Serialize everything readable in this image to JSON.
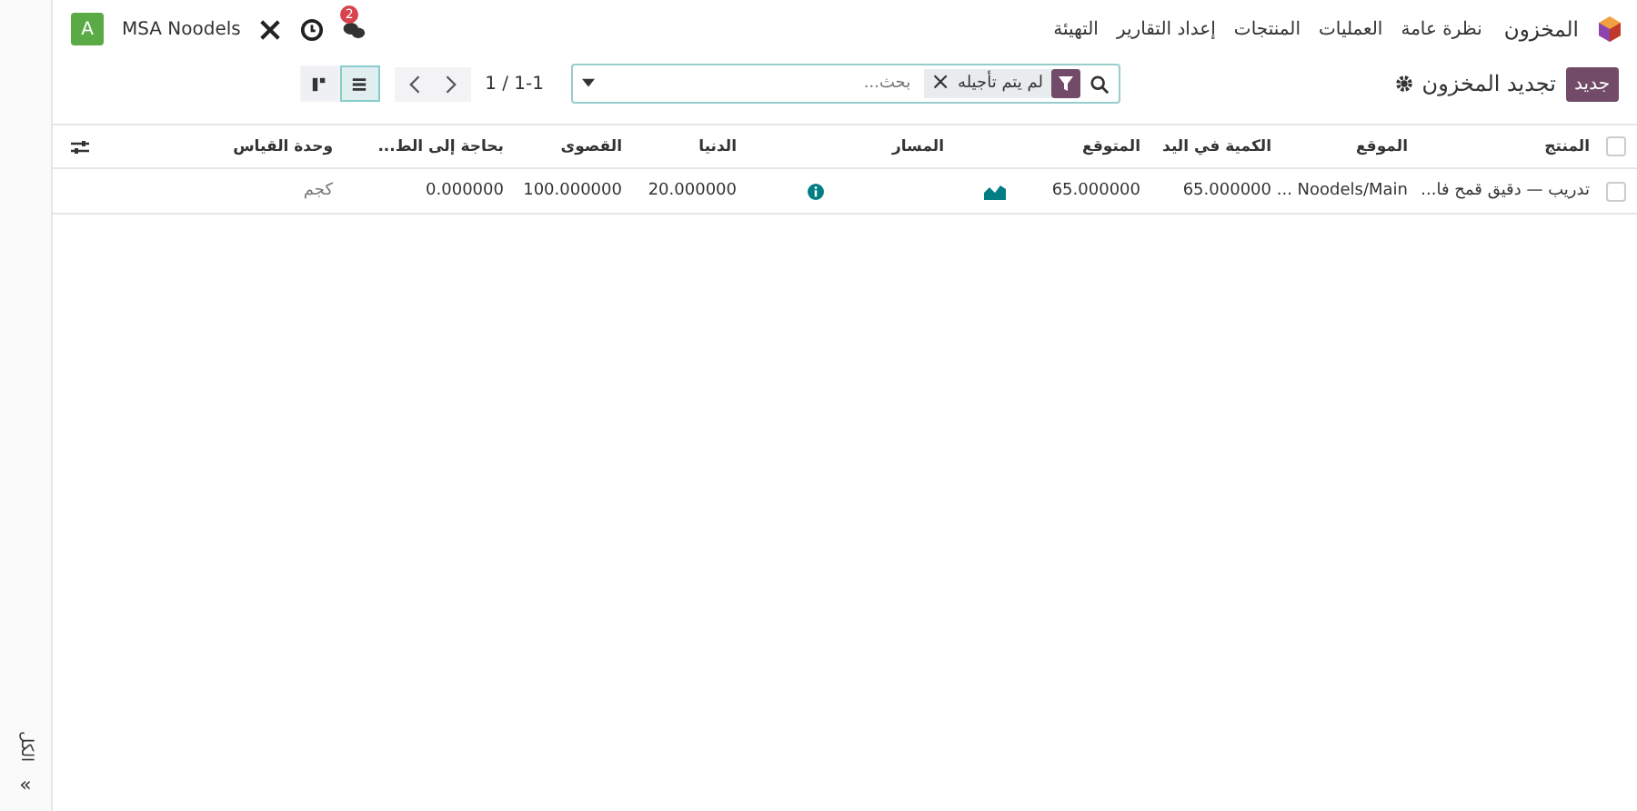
{
  "navbar": {
    "app_name": "المخزون",
    "menu": [
      "نظرة عامة",
      "العمليات",
      "المنتجات",
      "إعداد التقارير",
      "التهيئة"
    ],
    "messages_badge": "2",
    "company": "MSA Noodels",
    "avatar_letter": "A"
  },
  "control_panel": {
    "new_button": "جديد",
    "title": "تجديد المخزون",
    "search": {
      "placeholder": "بحث...",
      "facets": [
        {
          "label": "لم يتم تأجيله",
          "remove": "×"
        }
      ]
    },
    "pager": "1 / 1-1",
    "views": [
      {
        "kind": "kanban",
        "selected": false
      },
      {
        "kind": "list",
        "selected": true
      }
    ]
  },
  "table": {
    "columns": [
      "المنتج",
      "الموقع",
      "الكمية في اليد",
      "المتوقع",
      "المسار",
      "الدنيا",
      "القصوى",
      "بحاجة إلى الط...",
      "وحدة القياس"
    ],
    "select_all_checked": false,
    "rows": [
      {
        "product": "تدريب — دقيق قمح فا...",
        "location": "Noodels/Main ...",
        "on_hand": "65.000000",
        "forecast": "65.000000",
        "min": "20.000000",
        "max": "100.000000",
        "to_order": "0.000000",
        "uom": "كجم",
        "checked": false
      }
    ]
  },
  "side_panel": {
    "label": "الكل",
    "arrow": "»"
  }
}
